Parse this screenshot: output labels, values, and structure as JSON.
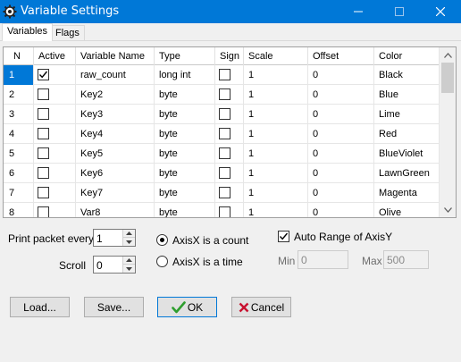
{
  "window": {
    "title": "Variable Settings",
    "icon": "gear-icon"
  },
  "tabs": [
    {
      "label": "Variables",
      "active": true
    },
    {
      "label": "Flags",
      "active": false
    }
  ],
  "grid": {
    "columns": [
      "N",
      "Active",
      "Variable Name",
      "Type",
      "Sign",
      "Scale",
      "Offset",
      "Color"
    ],
    "rows": [
      {
        "n": "1",
        "active": true,
        "name": "raw_count",
        "type": "long int",
        "sign": false,
        "scale": "1",
        "offset": "0",
        "color": "Black"
      },
      {
        "n": "2",
        "active": false,
        "name": "Key2",
        "type": "byte",
        "sign": false,
        "scale": "1",
        "offset": "0",
        "color": "Blue"
      },
      {
        "n": "3",
        "active": false,
        "name": "Key3",
        "type": "byte",
        "sign": false,
        "scale": "1",
        "offset": "0",
        "color": "Lime"
      },
      {
        "n": "4",
        "active": false,
        "name": "Key4",
        "type": "byte",
        "sign": false,
        "scale": "1",
        "offset": "0",
        "color": "Red"
      },
      {
        "n": "5",
        "active": false,
        "name": "Key5",
        "type": "byte",
        "sign": false,
        "scale": "1",
        "offset": "0",
        "color": "BlueViolet"
      },
      {
        "n": "6",
        "active": false,
        "name": "Key6",
        "type": "byte",
        "sign": false,
        "scale": "1",
        "offset": "0",
        "color": "LawnGreen"
      },
      {
        "n": "7",
        "active": false,
        "name": "Key7",
        "type": "byte",
        "sign": false,
        "scale": "1",
        "offset": "0",
        "color": "Magenta"
      },
      {
        "n": "8",
        "active": false,
        "name": "Var8",
        "type": "byte",
        "sign": false,
        "scale": "1",
        "offset": "0",
        "color": "Olive"
      }
    ]
  },
  "settings": {
    "print_packet_label": "Print packet every",
    "print_packet_value": "1",
    "scroll_label": "Scroll",
    "scroll_value": "0",
    "axis_count_label": "AxisX is a count",
    "axis_count_selected": true,
    "axis_time_label": "AxisX is a time",
    "auto_range_label": "Auto Range of AxisY",
    "auto_range_checked": true,
    "min_label": "Min",
    "min_value": "0",
    "max_label": "Max",
    "max_value": "500"
  },
  "buttons": {
    "load": "Load...",
    "save": "Save...",
    "ok": "OK",
    "cancel": "Cancel"
  },
  "colors": {
    "titlebar": "#0078d7",
    "selection": "#0078d7",
    "ok_check": "#2e9e2e",
    "cancel_x": "#c8102e"
  }
}
